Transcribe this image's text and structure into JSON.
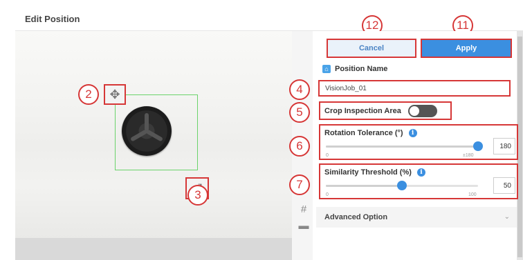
{
  "dialog": {
    "title": "Edit Position"
  },
  "toolbar": {
    "cancel_label": "Cancel",
    "apply_label": "Apply"
  },
  "position": {
    "label": "Position Name",
    "value": "VisionJob_01"
  },
  "crop": {
    "label": "Crop Inspection Area",
    "enabled": false
  },
  "rotation": {
    "label": "Rotation Tolerance (°)",
    "min": "0",
    "max": "±180",
    "value": "180",
    "value_fraction": 1.0
  },
  "similarity": {
    "label": "Similarity Threshold (%)",
    "min": "0",
    "max": "100",
    "value": "50",
    "value_fraction": 0.5
  },
  "advanced": {
    "label": "Advanced Option"
  },
  "callouts": {
    "move": "2",
    "resize": "3",
    "name": "4",
    "crop": "5",
    "rotation": "6",
    "similarity": "7",
    "apply": "11",
    "cancel": "12"
  },
  "icons": {
    "move": "move-icon",
    "resize": "resize-icon",
    "grid": "grid-icon",
    "toolbox": "toolbox-icon",
    "info": "info-icon",
    "chevron": "chevron-down-icon"
  },
  "colors": {
    "accent": "#3b8fe0",
    "callout": "#d63636",
    "roi": "#6ad36a"
  }
}
